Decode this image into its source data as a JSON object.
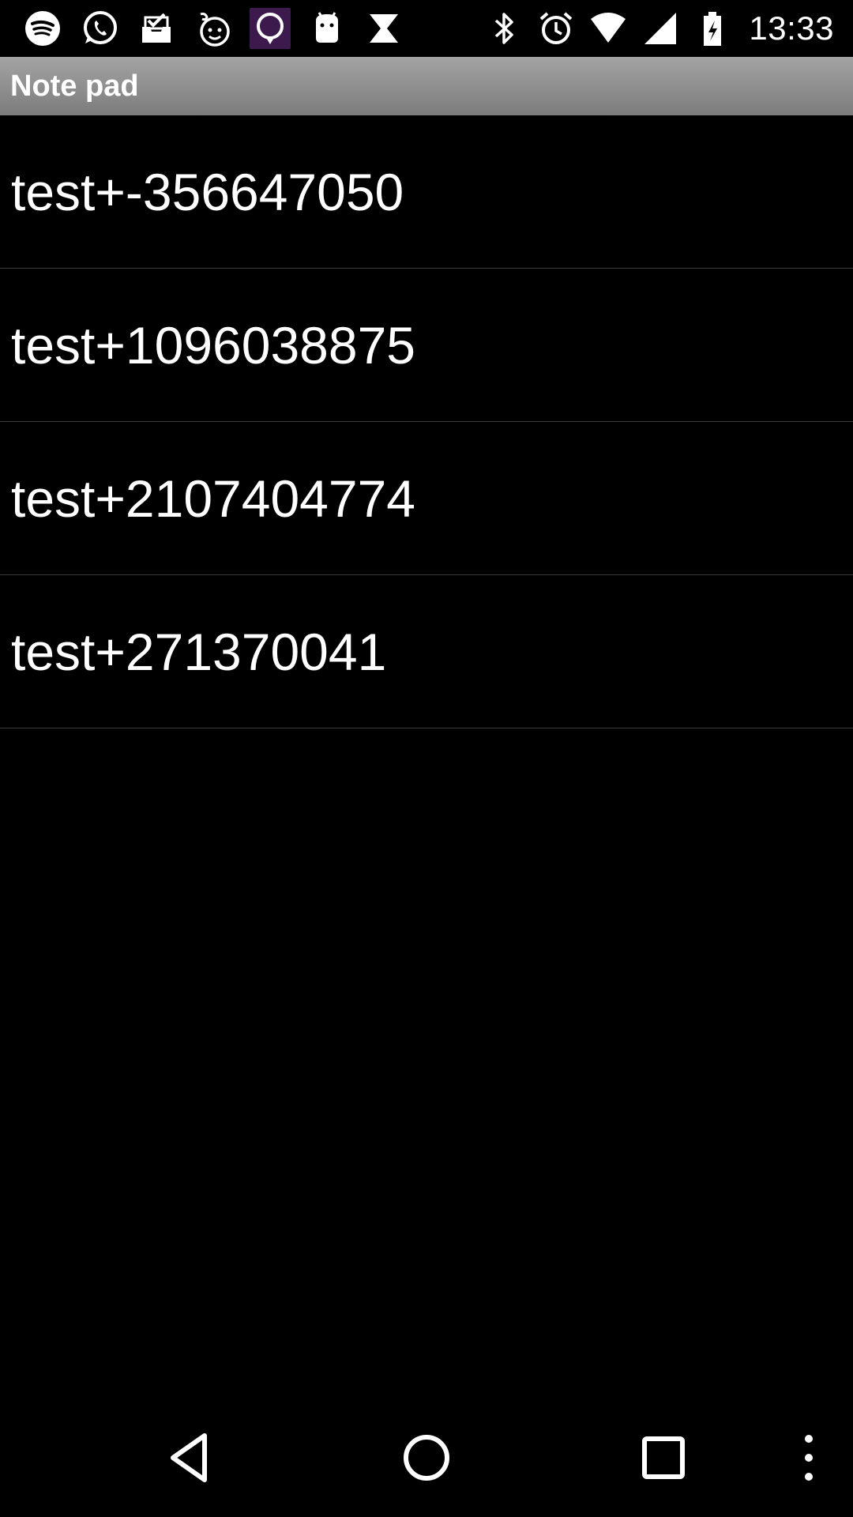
{
  "status_bar": {
    "left_icons": [
      "spotify-icon",
      "whatsapp-icon",
      "inbox-icon",
      "baby-face-icon",
      "location-pin-icon",
      "android-icon",
      "hourglass-icon"
    ],
    "right_icons": [
      "bluetooth-icon",
      "alarm-icon",
      "wifi-icon",
      "signal-icon",
      "battery-charging-icon"
    ],
    "time": "13:33"
  },
  "app": {
    "title": "Note pad"
  },
  "notes": [
    {
      "title": "test+-356647050"
    },
    {
      "title": "test+1096038875"
    },
    {
      "title": "test+2107404774"
    },
    {
      "title": "test+271370041"
    }
  ],
  "colors": {
    "background": "#000000",
    "title_bar": "#8f8f8f",
    "divider": "#3a3a3a",
    "text": "#ffffff"
  }
}
